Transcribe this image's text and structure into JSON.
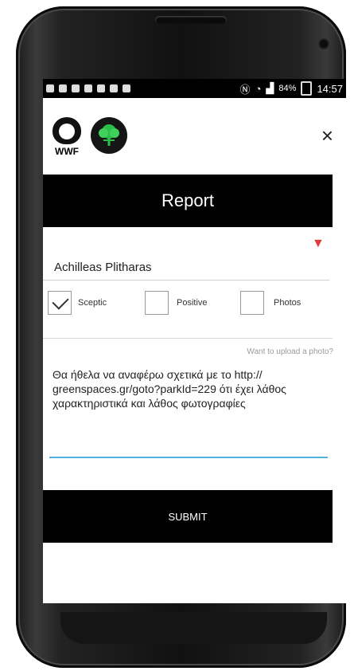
{
  "status": {
    "battery": "84%",
    "time": "14:57"
  },
  "app": {
    "brand": "WWF",
    "title": "Report",
    "name_value": "Achilleas Plitharas",
    "checkboxes": [
      {
        "label": "Sceptic",
        "checked": true
      },
      {
        "label": "Positive",
        "checked": false
      },
      {
        "label": "Photos",
        "checked": false
      }
    ],
    "upload_hint": "Want to upload a photo?",
    "message": "Θα ήθελα να αναφέρω σχετικά με το http:// greenspaces.gr/goto?parkId=229 ότι έχει λάθος χαρακτηριστικά και λάθος φωτογραφίες",
    "submit_label": "SUBMIT",
    "accent_color": "#e33b3b",
    "focus_color": "#4fb3dd"
  }
}
